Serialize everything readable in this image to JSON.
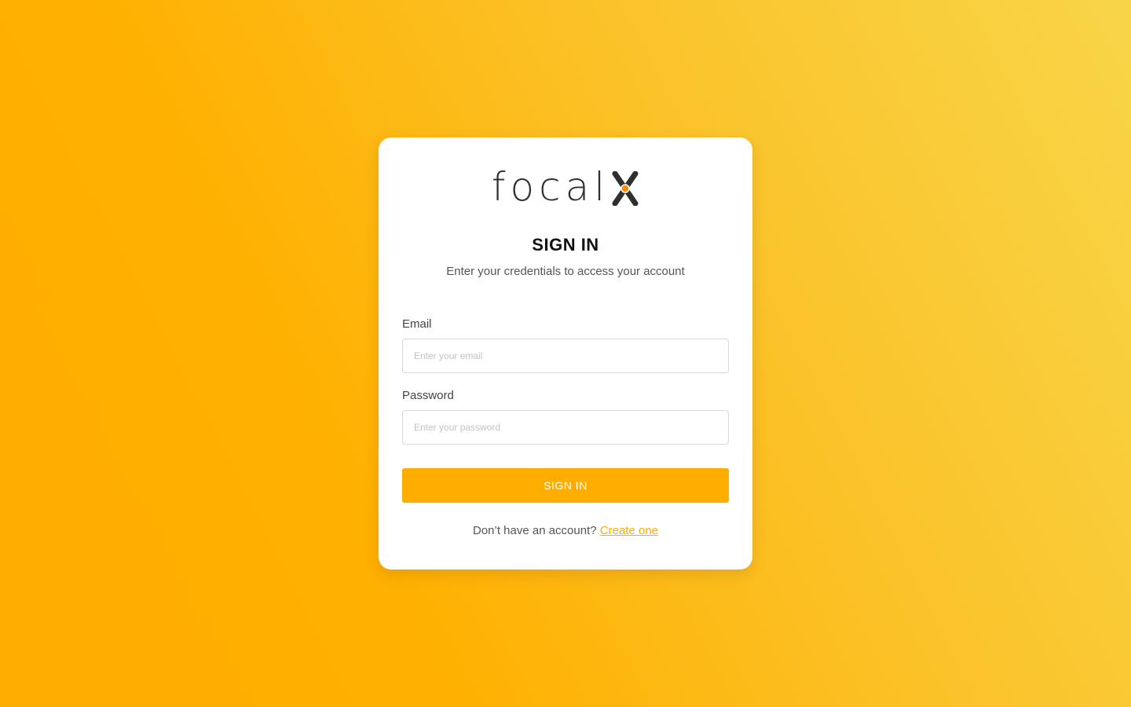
{
  "brand": {
    "logo_text": "focal",
    "logo_mark_icon": "x-mark-logo-icon",
    "logo_accent_color": "#ff8c00",
    "logo_color": "#2f2f2f"
  },
  "signin": {
    "title": "SIGN IN",
    "subtitle": "Enter your credentials to access your account",
    "email_label": "Email",
    "email_placeholder": "Enter your email",
    "email_value": "",
    "password_label": "Password",
    "password_placeholder": "Enter your password",
    "password_value": "",
    "submit_label": "SIGN IN",
    "footer_text": "Don’t have an account?",
    "create_link": "Create one"
  },
  "colors": {
    "accent": "#ffad00",
    "background_start": "#ffad00",
    "background_end": "#f8d548"
  }
}
